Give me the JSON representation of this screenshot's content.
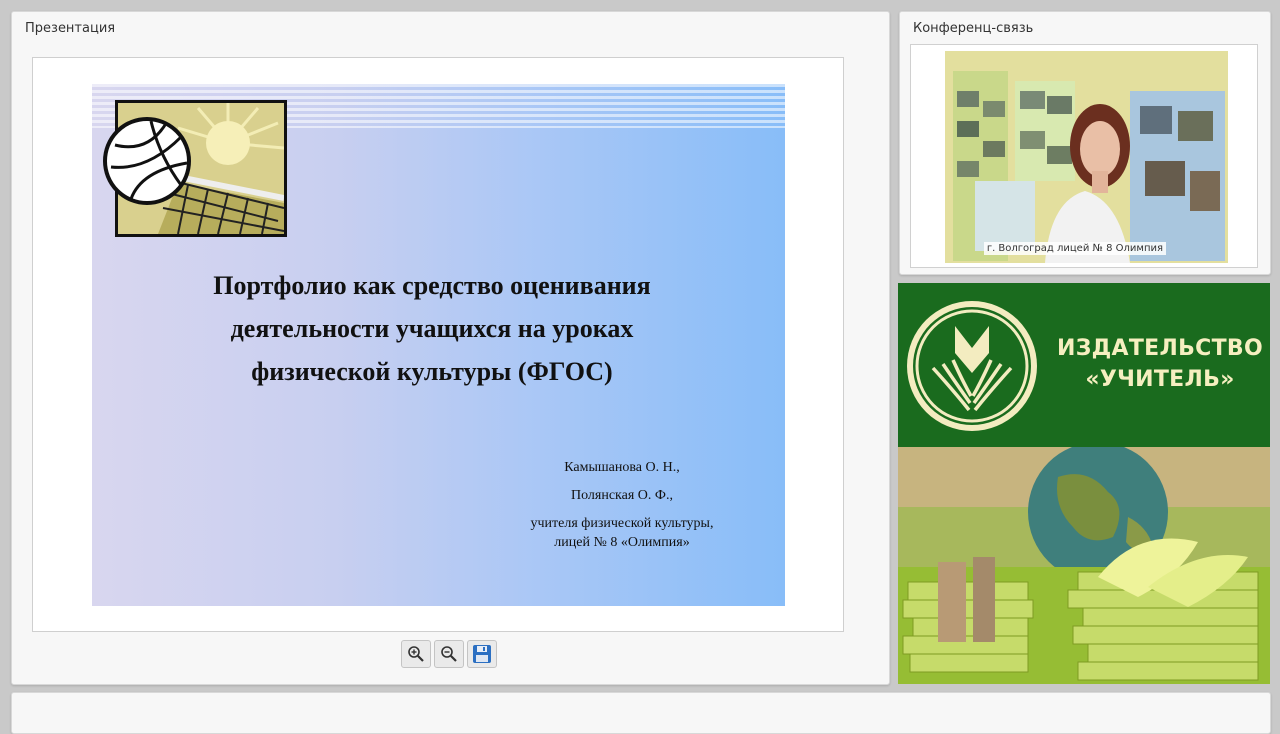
{
  "presentation_panel": {
    "title": "Презентация"
  },
  "conference_panel": {
    "title": "Конференц-связь",
    "video_caption": "г. Волгоград лицей № 8 Олимпия"
  },
  "slide": {
    "title_lines": [
      "Портфолио как средство оценивания",
      "деятельности  учащихся на уроках",
      "физической культуры (ФГОС)"
    ],
    "authors": [
      "Камышанова О. Н.,",
      "Полянская О. Ф.,",
      "учителя физической культуры,",
      "лицей № 8 «Олимпия»"
    ]
  },
  "toolbar": {
    "buttons": [
      {
        "name": "zoom-in",
        "icon": "magnifier-plus-icon"
      },
      {
        "name": "zoom-out",
        "icon": "magnifier-minus-icon"
      },
      {
        "name": "save",
        "icon": "floppy-disk-icon"
      }
    ]
  },
  "publisher": {
    "name_line1": "ИЗДАТЕЛЬСТВО",
    "name_line2": "«УЧИТЕЛЬ»"
  },
  "colors": {
    "publisher_green": "#1a6b1e",
    "publisher_text": "#f6efc0",
    "panel_bg": "#f7f7f7"
  }
}
